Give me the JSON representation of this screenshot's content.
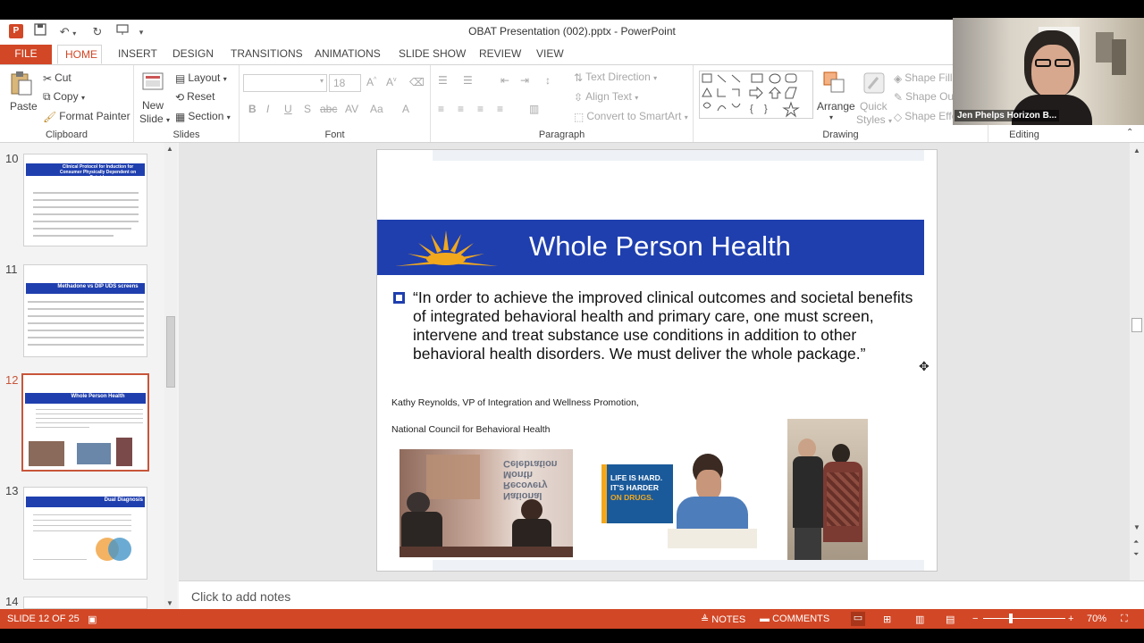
{
  "window": {
    "title": "OBAT Presentation (002).pptx - PowerPoint"
  },
  "tabs": [
    {
      "label": "FILE"
    },
    {
      "label": "HOME"
    },
    {
      "label": "INSERT"
    },
    {
      "label": "DESIGN"
    },
    {
      "label": "TRANSITIONS"
    },
    {
      "label": "ANIMATIONS"
    },
    {
      "label": "SLIDE SHOW"
    },
    {
      "label": "REVIEW"
    },
    {
      "label": "VIEW"
    }
  ],
  "ribbon": {
    "clipboard": {
      "label": "Clipboard",
      "paste": "Paste",
      "cut": "Cut",
      "copy": "Copy",
      "format_painter": "Format Painter"
    },
    "slides": {
      "label": "Slides",
      "new_slide": "New",
      "new_slide2": "Slide",
      "layout": "Layout",
      "reset": "Reset",
      "section": "Section"
    },
    "font": {
      "label": "Font",
      "size": "18"
    },
    "paragraph": {
      "label": "Paragraph",
      "text_direction": "Text Direction",
      "align_text": "Align Text",
      "convert_smartart": "Convert to SmartArt"
    },
    "drawing": {
      "label": "Drawing",
      "arrange": "Arrange",
      "quick_styles": "Quick",
      "quick_styles2": "Styles",
      "shape_fill": "Shape Fill",
      "shape_outline": "Shape Out",
      "shape_effects": "Shape Effe"
    },
    "editing": {
      "label": "Editing"
    }
  },
  "thumbnails": [
    {
      "num": "10",
      "title": "Clinical Protocol for Induction for Consumer Physically Dependent on Opioids"
    },
    {
      "num": "11",
      "title": "Methadone vs DIP UDS screens"
    },
    {
      "num": "12",
      "title": "Whole Person Health"
    },
    {
      "num": "13",
      "title": "Dual Diagnosis"
    },
    {
      "num": "14",
      "title": ""
    }
  ],
  "slide": {
    "title": "Whole Person Health",
    "quote": "“In order to achieve the improved clinical outcomes and societal benefits of integrated behavioral health and primary care, one must screen, intervene and treat substance use conditions in addition to other behavioral health disorders.  We must deliver the whole package.”",
    "attribution1": "Kathy Reynolds, VP of Integration and Wellness Promotion,",
    "attribution2": "National Council for Behavioral Health",
    "poster_text": "LIFE IS HARD. IT'S HARDER ON DRUGS.",
    "poster_line1": "LIFE IS HARD.",
    "poster_line2": "IT'S HARDER",
    "poster_line3": "ON DRUGS.",
    "photo1_text": "National Recovery Month Celebration"
  },
  "notes": {
    "placeholder": "Click to add notes"
  },
  "status": {
    "slide_info": "SLIDE 12 OF 25",
    "notes": "NOTES",
    "comments": "COMMENTS",
    "zoom": "70%"
  },
  "video": {
    "name": "Jen Phelps Horizon B..."
  },
  "colors": {
    "accent": "#d24726",
    "banner": "#1f3faf",
    "sun": "#f2a81d"
  }
}
